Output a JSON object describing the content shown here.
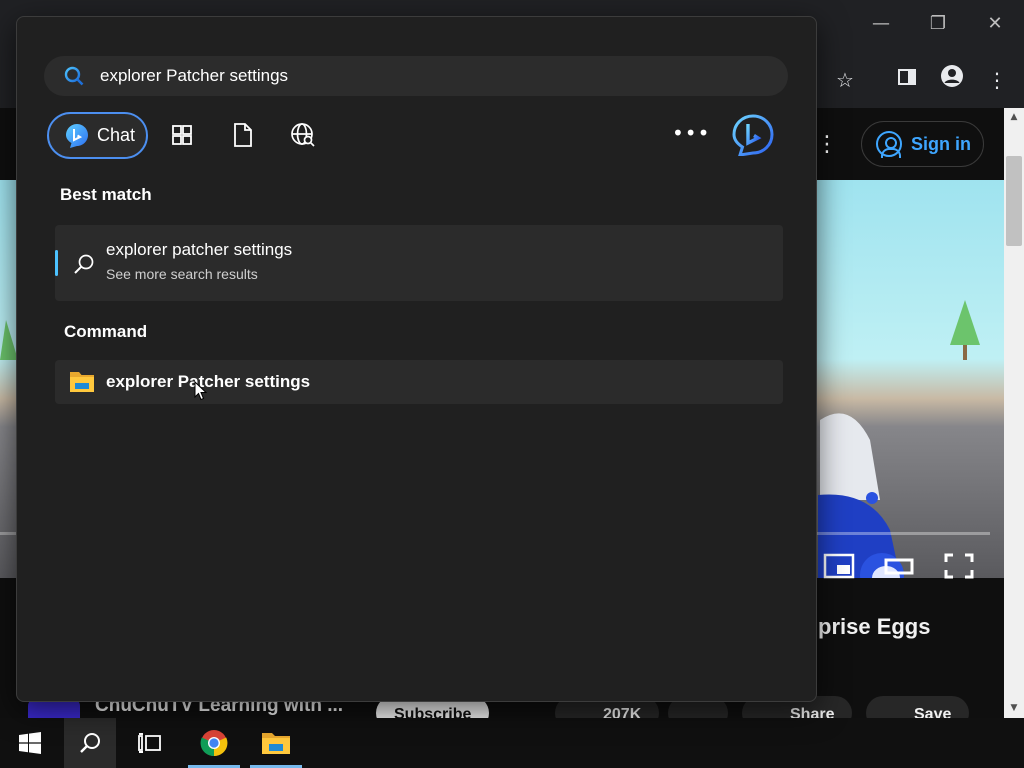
{
  "search": {
    "query": "explorer Patcher settings"
  },
  "scopes": {
    "chat_label": "Chat"
  },
  "best_match": {
    "heading": "Best match",
    "title": "explorer patcher settings",
    "subtitle": "See more search results"
  },
  "command": {
    "heading": "Command",
    "title": "explorer Patcher settings"
  },
  "youtube": {
    "sign_in_label": "Sign in",
    "video_title_fragment": "prise Eggs",
    "channel_name": "ChuChuTV Learning with ...",
    "subscribe_label": "Subscribe",
    "likes": "207K",
    "share_label": "Share",
    "save_label": "Save"
  },
  "colors": {
    "accent": "#4cc2ff",
    "chat_border": "#4c8ff0",
    "link_blue": "#3ea6ff"
  }
}
